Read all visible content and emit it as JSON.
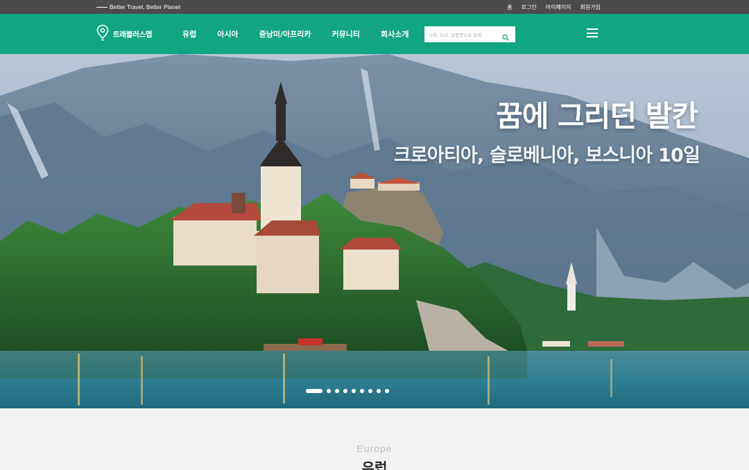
{
  "topbar": {
    "tagline": "Better Travel, Better Planet",
    "links": [
      "홈",
      "로그인",
      "마이페이지",
      "회원가입"
    ]
  },
  "nav": {
    "logo_text": "트래블러스맵",
    "menu": [
      "유럽",
      "아시아",
      "중남미/아프리카",
      "커뮤니티",
      "회사소개"
    ],
    "search_placeholder": "나라, 도시, 상품명으로 검색",
    "icons": [
      "map-pin-icon",
      "search-icon",
      "hamburger-menu-icon"
    ]
  },
  "hero": {
    "title": "꿈에 그리던 발칸",
    "subtitle": "크로아티아, 슬로베니아, 보스니아 10일",
    "slide_count": 9,
    "active_slide": 1
  },
  "section": {
    "title_en": "Europe",
    "title_ko": "유럽"
  },
  "colors": {
    "brand_green": "#12a582",
    "topbar_bg": "#4b4b4b",
    "section_bg": "#f2f2f2"
  }
}
